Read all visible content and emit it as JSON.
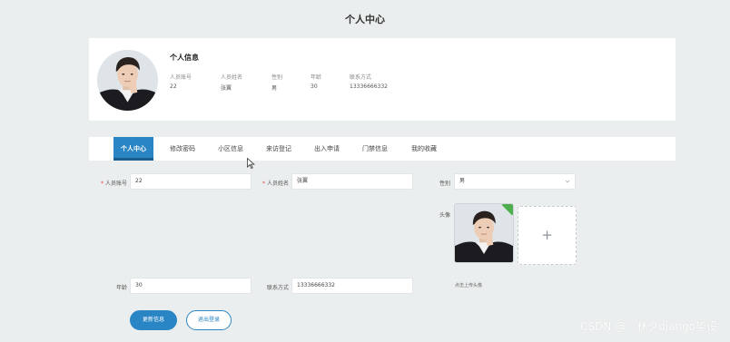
{
  "page": {
    "title": "个人中心"
  },
  "profile": {
    "section_title": "个人信息",
    "fields": [
      {
        "label": "人员账号",
        "value": "22"
      },
      {
        "label": "人员姓名",
        "value": "张翼"
      },
      {
        "label": "性别",
        "value": "男"
      },
      {
        "label": "年龄",
        "value": "30"
      },
      {
        "label": "联系方式",
        "value": "13336666332"
      }
    ]
  },
  "tabs": [
    {
      "label": "个人中心",
      "active": true
    },
    {
      "label": "修改密码",
      "active": false
    },
    {
      "label": "小区信息",
      "active": false
    },
    {
      "label": "来访登记",
      "active": false
    },
    {
      "label": "出入申请",
      "active": false
    },
    {
      "label": "门禁信息",
      "active": false
    },
    {
      "label": "我的收藏",
      "active": false
    }
  ],
  "form": {
    "account": {
      "label": "人员账号",
      "required": "*",
      "value": "22"
    },
    "name": {
      "label": "人员姓名",
      "required": "*",
      "value": "张翼"
    },
    "gender": {
      "label": "性别",
      "value": "男"
    },
    "avatar": {
      "label": "头像",
      "upload_hint": "点击上传头像",
      "plus": "+"
    },
    "age": {
      "label": "年龄",
      "value": "30"
    },
    "phone": {
      "label": "联系方式",
      "value": "13336666332"
    }
  },
  "buttons": {
    "update": "更新信息",
    "logout": "退出登录"
  },
  "watermark": "CSDN @゛林夕django毕设",
  "colors": {
    "accent": "#2a85c4",
    "background": "#ebeeee",
    "required": "#e0443a"
  }
}
